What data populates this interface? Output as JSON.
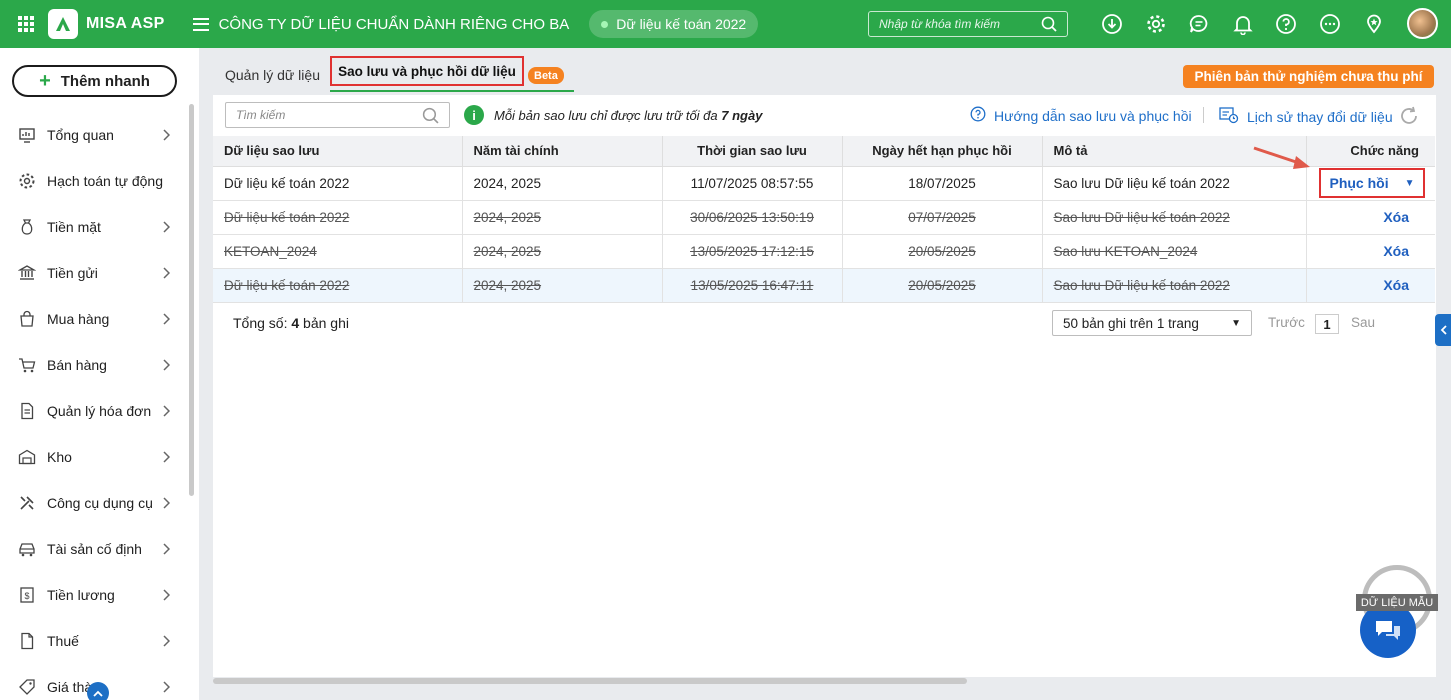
{
  "header": {
    "logo_text": "MISA ASP",
    "company": "CÔNG TY DỮ LIỆU CHUẨN DÀNH RIÊNG CHO BA",
    "database": "Dữ liệu kế toán 2022",
    "search_placeholder": "Nhập từ khóa tìm kiếm",
    "icons": [
      "download-icon",
      "gear-icon",
      "chat-icon",
      "bell-icon",
      "help-icon",
      "more-icon",
      "location-icon"
    ],
    "brand_color": "#2ba84a"
  },
  "sidebar": {
    "quick_add": "Thêm nhanh",
    "items": [
      {
        "label": "Tổng quan",
        "icon": "dashboard-icon"
      },
      {
        "label": "Hạch toán tự động",
        "icon": "auto-gear-icon"
      },
      {
        "label": "Tiền mặt",
        "icon": "money-bag-icon"
      },
      {
        "label": "Tiền gửi",
        "icon": "bank-icon"
      },
      {
        "label": "Mua hàng",
        "icon": "shopping-bag-icon"
      },
      {
        "label": "Bán hàng",
        "icon": "cart-icon"
      },
      {
        "label": "Quản lý hóa đơn",
        "icon": "invoice-icon"
      },
      {
        "label": "Kho",
        "icon": "warehouse-icon"
      },
      {
        "label": "Công cụ dụng cụ",
        "icon": "tools-icon"
      },
      {
        "label": "Tài sản cố định",
        "icon": "car-icon"
      },
      {
        "label": "Tiền lương",
        "icon": "payroll-icon"
      },
      {
        "label": "Thuế",
        "icon": "tax-doc-icon"
      },
      {
        "label": "Giá thà",
        "icon": "price-tag-icon"
      }
    ]
  },
  "tabs": {
    "manage": "Quản lý dữ liệu",
    "backup": "Sao lưu và phục hồi dữ liệu",
    "beta": "Beta",
    "trial": "Phiên bản thử nghiệm chưa thu phí"
  },
  "toolbar": {
    "search_placeholder": "Tìm kiếm",
    "info_prefix": "Mỗi bản sao lưu chỉ được lưu trữ tối đa ",
    "info_bold": "7 ngày",
    "guide": "Hướng dẫn sao lưu và phục hồi",
    "history": "Lịch sử thay đổi dữ liệu"
  },
  "table": {
    "columns": [
      "Dữ liệu sao lưu",
      "Năm tài chính",
      "Thời gian sao lưu",
      "Ngày hết hạn phục hồi",
      "Mô tả",
      "Chức năng"
    ],
    "rows": [
      {
        "data": "Dữ liệu kế toán 2022",
        "year": "2024, 2025",
        "time": "11/07/2025 08:57:55",
        "expiry": "18/07/2025",
        "desc": "Sao lưu Dữ liệu kế toán 2022",
        "action": "Phục hồi"
      },
      {
        "data": "Dữ liệu kế toán 2022",
        "year": "2024, 2025",
        "time": "30/06/2025 13:50:19",
        "expiry": "07/07/2025",
        "desc": "Sao lưu Dữ liệu kế toán 2022",
        "action": "Xóa"
      },
      {
        "data": "KETOAN_2024",
        "year": "2024, 2025",
        "time": "13/05/2025 17:12:15",
        "expiry": "20/05/2025",
        "desc": "Sao lưu KETOAN_2024",
        "action": "Xóa"
      },
      {
        "data": "Dữ liệu kế toán 2022",
        "year": "2024, 2025",
        "time": "13/05/2025 16:47:11",
        "expiry": "20/05/2025",
        "desc": "Sao lưu Dữ liệu kế toán 2022",
        "action": "Xóa"
      }
    ]
  },
  "footer": {
    "total_prefix": "Tổng số: ",
    "total_count": "4",
    "total_suffix": " bản ghi",
    "page_size": "50 bản ghi trên 1 trang",
    "prev": "Trước",
    "page": "1",
    "next": "Sau"
  },
  "badge": {
    "label": "DỮ LIỆU MẪU"
  }
}
